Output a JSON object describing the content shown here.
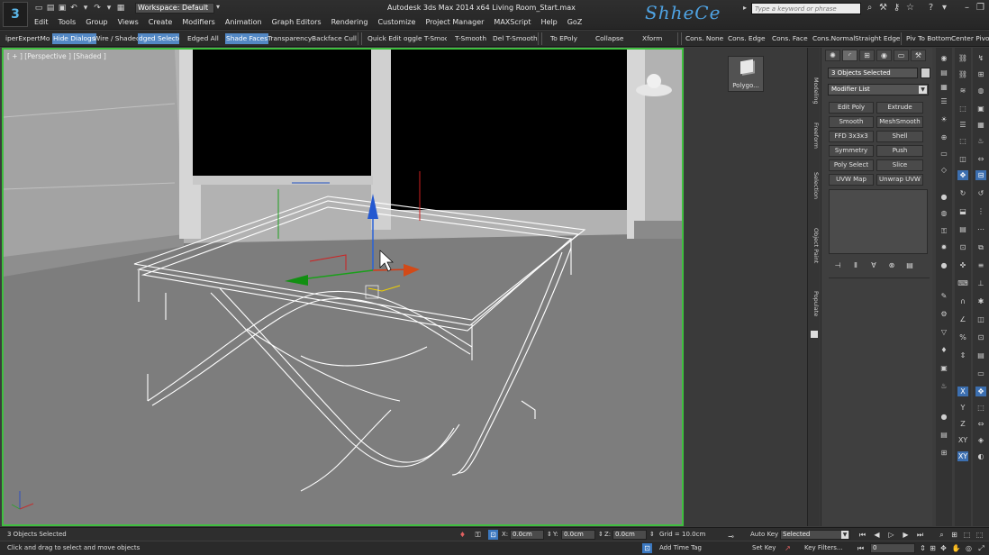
{
  "app": {
    "logo": "3",
    "workspace": "Workspace: Default",
    "title": "Autodesk 3ds Max  2014 x64    Living Room_Start.max",
    "brand": "ShheCe",
    "search_placeholder": "Type a keyword or phrase"
  },
  "menu": [
    "Edit",
    "Tools",
    "Group",
    "Views",
    "Create",
    "Modifiers",
    "Animation",
    "Graph Editors",
    "Rendering",
    "Customize",
    "Project Manager",
    "MAXScript",
    "Help",
    "GoZ"
  ],
  "ribbon": {
    "superexpert": "iperExpertMo",
    "hide_dialogs": "Hide Dialogs",
    "wire_shaded": "Wire / Shaded",
    "edged_selected": "dged Selecte",
    "edged_all": "Edged All",
    "shade_faces": "Shade Faces",
    "transparency": "Transparency",
    "backface_cull": "Backface Cull",
    "quick_edit": "Quick Edit",
    "toggle_tsmooth": "oggle T-Smoo",
    "tsmooth": "T-Smooth",
    "del_tsmooth": "Del T-Smooth",
    "to_epoly": "To  EPoly",
    "collapse": "Collapse",
    "xform": "Xform",
    "cons_none": "Cons. None",
    "cons_edge": "Cons. Edge",
    "cons_face": "Cons. Face",
    "cons_normal": "Cons.Normal",
    "straight_edge": "Straight Edge",
    "piv_bottom": "Piv To Bottom",
    "center_pivot": "Center Pivot"
  },
  "viewport": {
    "label": "[ + ] [Perspective ] [Shaded ]"
  },
  "object_button": "Polygo...",
  "vtabs": [
    "Modeling",
    "Freeform",
    "Selection",
    "Object Paint",
    "Populate"
  ],
  "command_panel": {
    "object_name": "3 Objects Selected",
    "modifier_list": "Modifier List",
    "buttons": [
      "Edit Poly",
      "Extrude",
      "Smooth",
      "MeshSmooth",
      "FFD 3x3x3",
      "Shell",
      "Symmetry",
      "Push",
      "Poly Select",
      "Slice",
      "UVW Map",
      "Unwrap UVW"
    ]
  },
  "status": {
    "selected": "3 Objects Selected",
    "prompt": "Click and drag to select and move objects",
    "x_label": "X:",
    "x_value": "0.0cm",
    "y_label": "Y:",
    "y_value": "0.0cm",
    "z_label": "Z:",
    "z_value": "0.0cm",
    "grid": "Grid = 10.0cm",
    "add_time_tag": "Add Time Tag",
    "auto_key": "Auto Key",
    "set_key": "Set Key",
    "selected_dropdown": "Selected",
    "key_filters": "Key Filters...",
    "frame": "0"
  },
  "colors": {
    "viewport_border": "#3fbf3f",
    "selection_blue": "#5388c4",
    "brand_blue": "#4fa3e3"
  }
}
